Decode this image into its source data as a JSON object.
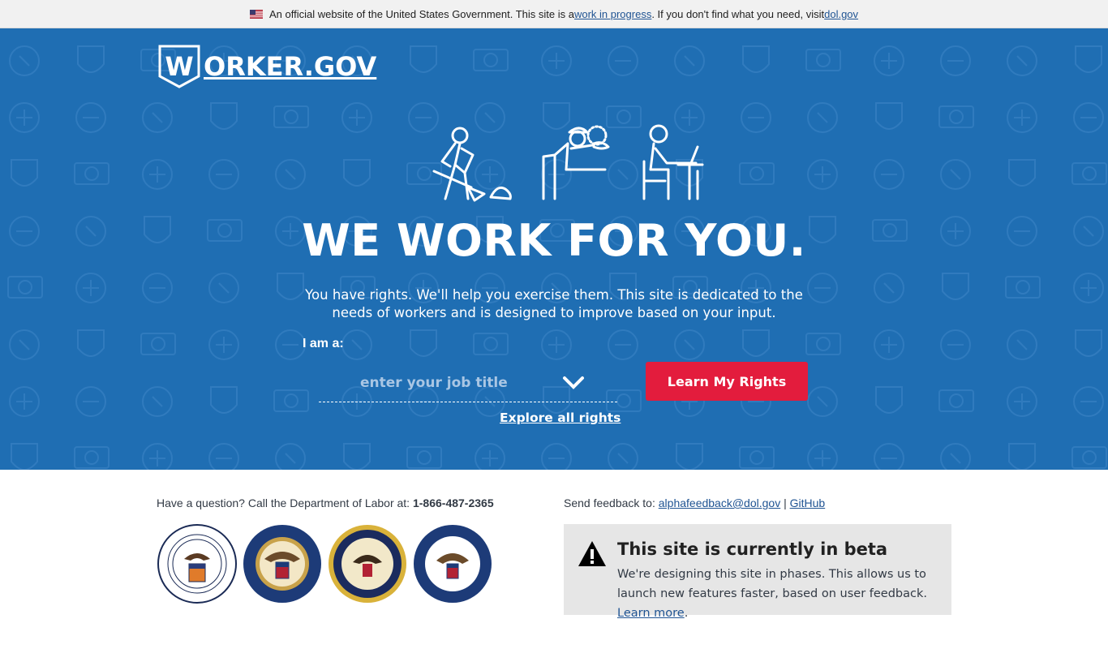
{
  "banner": {
    "text_before": "An official website of the United States Government. This site is a ",
    "link1": "work in progress",
    "text_middle": ". If you don't find what you need, visit ",
    "link2": "dol.gov",
    "flag_icon": "us-flag-icon"
  },
  "header": {
    "logo_text": "ORKER.GOV",
    "logo_letter": "W"
  },
  "hero": {
    "headline": "WE WORK FOR YOU.",
    "subhead": "You have rights. We'll help you exercise them. This site is dedicated to the needs of workers and is designed to improve based on your input.",
    "iam_label": "I am a:",
    "job_placeholder": "enter your job title",
    "learn_button": "Learn My Rights",
    "explore_link": "Explore all rights",
    "illustration_icons": [
      "shovel-worker-icon",
      "mechanic-worker-icon",
      "desk-worker-icon"
    ]
  },
  "footer": {
    "question_text": "Have a question? Call the Department of Labor at: ",
    "phone": "1-866-487-2365",
    "seals": [
      "department-of-labor-seal",
      "nlrb-seal",
      "department-of-justice-seal",
      "eeoc-seal"
    ],
    "feedback_text": "Send feedback to: ",
    "feedback_email": "alphafeedback@dol.gov",
    "separator": " | ",
    "github": "GitHub"
  },
  "beta": {
    "title": "This site is currently in beta",
    "text": "We're designing this site in phases. This allows us to launch new features faster, based on user feedback. ",
    "learn_more": "Learn more",
    "period": "."
  },
  "colors": {
    "hero_blue": "#1f6eb3",
    "button_red": "#e31c3d",
    "link_blue": "#205493"
  }
}
